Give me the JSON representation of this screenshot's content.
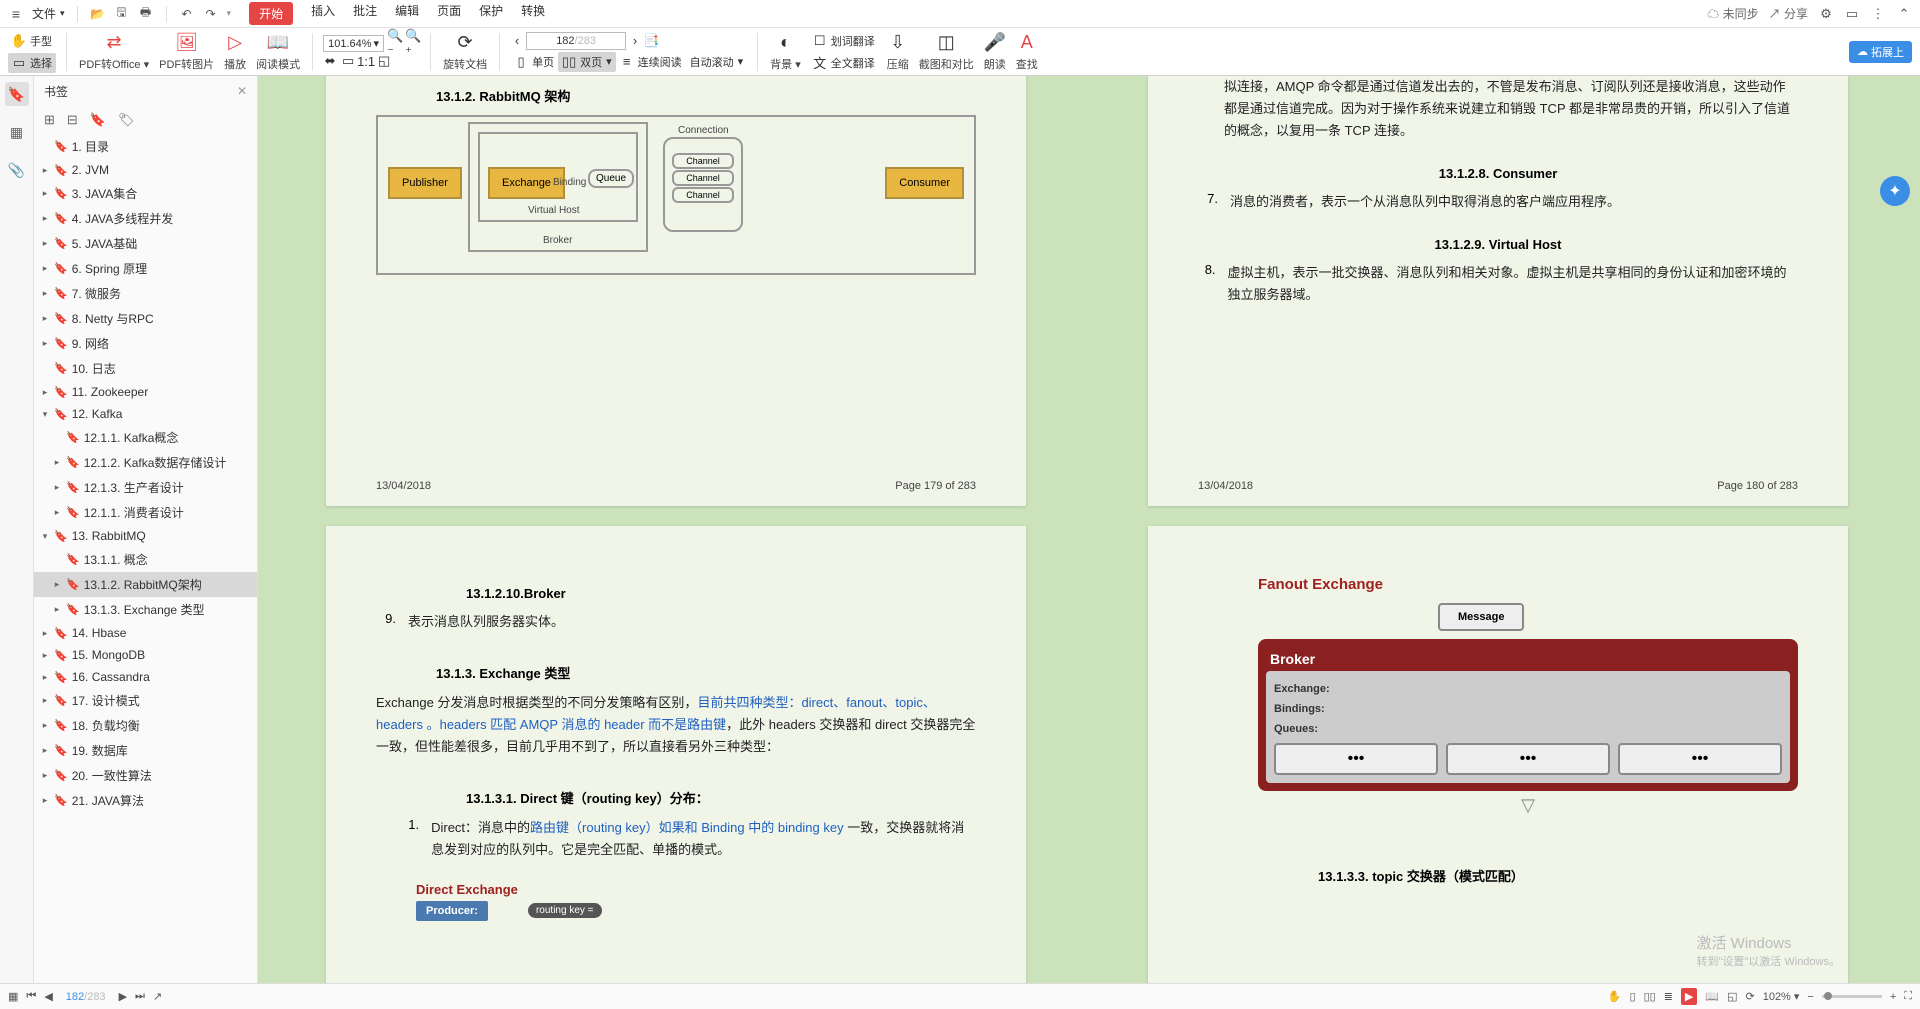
{
  "menubar": {
    "file": "文件",
    "tabs": [
      "开始",
      "插入",
      "批注",
      "编辑",
      "页面",
      "保护",
      "转换"
    ],
    "right": {
      "sync": "未同步",
      "share": "分享"
    }
  },
  "ribbon": {
    "hand": "手型",
    "select": "选择",
    "pdf2office": "PDF转Office",
    "pdf2pic": "PDF转图片",
    "play": "播放",
    "readmode": "阅读模式",
    "zoom": "101.64%",
    "rotate": "旋转文档",
    "singlepage": "单页",
    "dualpage": "双页",
    "continuous": "连续阅读",
    "autoscroll": "自动滚动",
    "pagecur": "182",
    "pagetotal": "/283",
    "bg": "背景",
    "wordtrans": "划词翻译",
    "fulltrans": "全文翻译",
    "compress": "压缩",
    "crop": "截图和对比",
    "read": "朗读",
    "find": "查找",
    "upload": "拓展上"
  },
  "sidebar": {
    "title": "书签",
    "items": [
      {
        "l": "1. 目录",
        "i": 0,
        "a": ""
      },
      {
        "l": "2. JVM",
        "i": 0,
        "a": "▸"
      },
      {
        "l": "3. JAVA集合",
        "i": 0,
        "a": "▸"
      },
      {
        "l": "4. JAVA多线程并发",
        "i": 0,
        "a": "▸"
      },
      {
        "l": "5. JAVA基础",
        "i": 0,
        "a": "▸"
      },
      {
        "l": "6. Spring 原理",
        "i": 0,
        "a": "▸"
      },
      {
        "l": "7.   微服务",
        "i": 0,
        "a": "▸"
      },
      {
        "l": "8. Netty 与RPC",
        "i": 0,
        "a": "▸"
      },
      {
        "l": "9. 网络",
        "i": 0,
        "a": "▸"
      },
      {
        "l": "10. 日志",
        "i": 0,
        "a": ""
      },
      {
        "l": "11. Zookeeper",
        "i": 0,
        "a": "▸"
      },
      {
        "l": "12. Kafka",
        "i": 0,
        "a": "▾"
      },
      {
        "l": "12.1.1. Kafka概念",
        "i": 1,
        "a": ""
      },
      {
        "l": "12.1.2. Kafka数据存储设计",
        "i": 1,
        "a": "▸"
      },
      {
        "l": "12.1.3. 生产者设计",
        "i": 1,
        "a": "▸"
      },
      {
        "l": "12.1.1. 消费者设计",
        "i": 1,
        "a": "▸"
      },
      {
        "l": "13. RabbitMQ",
        "i": 0,
        "a": "▾"
      },
      {
        "l": "13.1.1. 概念",
        "i": 1,
        "a": ""
      },
      {
        "l": "13.1.2. RabbitMQ架构",
        "i": 1,
        "a": "▸",
        "sel": true
      },
      {
        "l": "13.1.3.  Exchange 类型",
        "i": 1,
        "a": "▸"
      },
      {
        "l": "14. Hbase",
        "i": 0,
        "a": "▸"
      },
      {
        "l": "15. MongoDB",
        "i": 0,
        "a": "▸"
      },
      {
        "l": "16. Cassandra",
        "i": 0,
        "a": "▸"
      },
      {
        "l": "17. 设计模式",
        "i": 0,
        "a": "▸"
      },
      {
        "l": "18. 负载均衡",
        "i": 0,
        "a": "▸"
      },
      {
        "l": "19. 数据库",
        "i": 0,
        "a": "▸"
      },
      {
        "l": "20. 一致性算法",
        "i": 0,
        "a": "▸"
      },
      {
        "l": "21. JAVA算法",
        "i": 0,
        "a": "▸"
      }
    ]
  },
  "pg1": {
    "h": "13.1.2.    RabbitMQ 架构",
    "diag": {
      "pub": "Publisher",
      "ex": "Exchange",
      "bind": "Binding",
      "q": "Queue",
      "vh": "Virtual Host",
      "brk": "Broker",
      "conn": "Connection",
      "chan": "Channel",
      "cons": "Consumer"
    },
    "date": "13/04/2018",
    "pn": "Page 179 of 283"
  },
  "pg2": {
    "t1": "拟连接，AMQP 命令都是通过信道发出去的，不管是发布消息、订阅队列还是接收消息，这些动作都是通过信道完成。因为对于操作系统来说建立和销毁 TCP 都是非常昂贵的开销，所以引入了信道的概念，以复用一条 TCP 连接。",
    "h1": "13.1.2.8.  Consumer",
    "t2n": "7.",
    "t2": "消息的消费者，表示一个从消息队列中取得消息的客户端应用程序。",
    "h2": "13.1.2.9.  Virtual Host",
    "t3n": "8.",
    "t3": "虚拟主机，表示一批交换器、消息队列和相关对象。虚拟主机是共享相同的身份认证和加密环境的独立服务器域。",
    "date": "13/04/2018",
    "pn": "Page 180 of 283"
  },
  "pg3": {
    "h1": "13.1.2.10.Broker",
    "t1n": "9.",
    "t1": "表示消息队列服务器实体。",
    "h2": "13.1.3.    Exchange 类型",
    "t2a": "Exchange 分发消息时根据类型的不同分发策略有区别，",
    "t2b": "目前共四种类型：direct、fanout、topic、headers 。headers 匹配 AMQP 消息的 header 而不是路由键",
    "t2c": "，此外 headers 交换器和 direct 交换器完全一致，但性能差很多，目前几乎用不到了，所以直接看另外三种类型：",
    "h3": "13.1.3.1.  Direct 键（routing key）分布：",
    "t3n": "1.",
    "t3a": "Direct：消息中的",
    "t3b": "路由键（routing key）如果和 Binding 中的 binding key ",
    "t3c": "一致，交换器就将消息发到对应的队列中。它是完全匹配、单播的模式。",
    "de": "Direct Exchange",
    "prod": "Producer:",
    "rk": "routing key ="
  },
  "pg4": {
    "fanout": "Fanout Exchange",
    "msg": "Message",
    "broker": "Broker",
    "ex": "Exchange:",
    "bind": "Bindings:",
    "q": "Queues:",
    "h": "13.1.3.3.         topic 交换器（模式匹配）"
  },
  "watermark": {
    "t1": "激活 Windows",
    "t2": "转到\"设置\"以激活 Windows。"
  },
  "status": {
    "pg": "182",
    "pt": "/283",
    "zoom": "102%"
  }
}
